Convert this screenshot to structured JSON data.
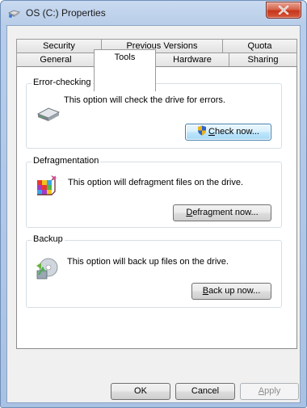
{
  "window": {
    "title": "OS (C:) Properties"
  },
  "tabs": {
    "row1": [
      {
        "label": "Security"
      },
      {
        "label": "Previous Versions"
      },
      {
        "label": "Quota"
      }
    ],
    "row2": [
      {
        "label": "General"
      },
      {
        "label": "Tools"
      },
      {
        "label": "Hardware"
      },
      {
        "label": "Sharing"
      }
    ],
    "selected": "Tools"
  },
  "groups": {
    "error_checking": {
      "label": "Error-checking",
      "text": "This option will check the drive for errors.",
      "button_accel": "C",
      "button_rest": "heck now...",
      "icon": "drive-check-icon"
    },
    "defragmentation": {
      "label": "Defragmentation",
      "text": "This option will defragment files on the drive.",
      "button_accel": "D",
      "button_rest": "efragment now...",
      "icon": "defragment-icon"
    },
    "backup": {
      "label": "Backup",
      "text": "This option will back up files on the drive.",
      "button_accel": "B",
      "button_rest": "ack up now...",
      "icon": "backup-icon"
    }
  },
  "footer": {
    "ok": "OK",
    "cancel": "Cancel",
    "apply_accel": "A",
    "apply_rest": "pply"
  }
}
